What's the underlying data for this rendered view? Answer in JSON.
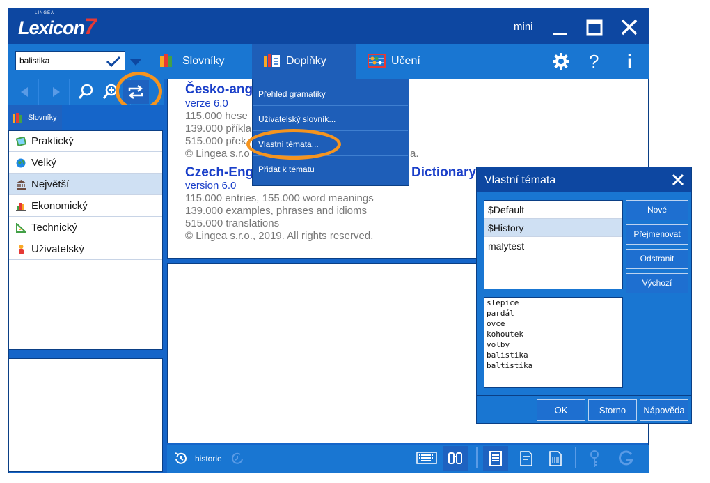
{
  "app": {
    "logo_brand": "LINGEA",
    "logo_text": "Lexicon",
    "logo_number": "7"
  },
  "window_controls": {
    "mini_label": "mini"
  },
  "search": {
    "value": "balistika"
  },
  "tabs": [
    {
      "label": "Slovníky"
    },
    {
      "label": "Doplňky"
    },
    {
      "label": "Učení"
    }
  ],
  "toolbar_right": {
    "help_label": "?",
    "info_label": "i"
  },
  "left_pane": {
    "tab_label": "Slovníky",
    "dictionaries": [
      {
        "label": "Praktický",
        "icon": "book-icon"
      },
      {
        "label": "Velký",
        "icon": "globe-icon"
      },
      {
        "label": "Největší",
        "icon": "building-icon",
        "selected": true
      },
      {
        "label": "Ekonomický",
        "icon": "bar-chart-icon"
      },
      {
        "label": "Technický",
        "icon": "triangle-ruler-icon"
      },
      {
        "label": "Uživatelský",
        "icon": "user-icon"
      }
    ]
  },
  "content": {
    "entries": [
      {
        "title": "Česko-ang",
        "version": "verze 6.0",
        "lines": [
          "115.000 hese",
          "139.000 příkla",
          "515.000 přek",
          "© Lingea s.r.o"
        ],
        "line_tail": "a."
      },
      {
        "title": "Czech-Eng",
        "title_tail": "Dictionary",
        "version": "version 6.0",
        "lines": [
          "115.000 entries, 155.000 word meanings",
          "139.000 examples, phrases and idioms",
          "515.000 translations",
          "© Lingea s.r.o., 2019. All rights reserved."
        ]
      }
    ]
  },
  "dropdown": {
    "items": [
      "Přehled gramatiky",
      "Uživatelský slovník...",
      "Vlastní témata...",
      "Přidat k tématu"
    ]
  },
  "bottom_bar": {
    "history_label": "historie"
  },
  "dialog": {
    "title": "Vlastní témata",
    "themes": [
      "$Default",
      "$History",
      "malytest"
    ],
    "selected_theme": "$History",
    "words": [
      "slepice",
      "pardál",
      "ovce",
      "kohoutek",
      "volby",
      "balistika",
      "baltistika"
    ],
    "buttons": [
      "Nové",
      "Přejmenovat",
      "Odstranit",
      "Výchozí"
    ],
    "footer_buttons": [
      "OK",
      "Storno",
      "Nápověda"
    ]
  },
  "colors": {
    "dark_blue": "#0d47a1",
    "blue": "#1976d2",
    "highlight_orange": "#f5941f",
    "link_blue": "#1a3fc9",
    "logo_red": "#e53935"
  }
}
